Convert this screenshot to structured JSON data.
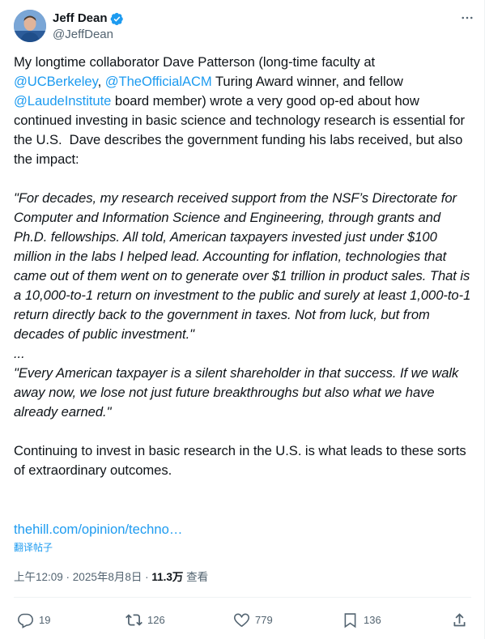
{
  "author": {
    "display_name": "Jeff Dean",
    "handle": "@JeffDean",
    "verified": true,
    "verified_color": "#1d9bf0"
  },
  "tweet": {
    "p1_a": "My longtime collaborator Dave Patterson (long-time faculty at",
    "mention_ucb": "@UCBerkeley",
    "comma": ", ",
    "mention_acm": "@TheOfficialACM",
    "p1_b": " Turing Award winner, and fellow",
    "mention_laude": "@LaudeInstitute",
    "p1_c": " board member) wrote a very good op-ed about how continued investing in basic science and technology research is essential for the U.S.  Dave describes the government funding his labs received, but also the impact:",
    "quote1": "\"For decades, my research received support from the NSF’s Directorate for Computer and Information Science and Engineering, through grants and Ph.D. fellowships. All told, American taxpayers invested just under $100 million in the labs I helped lead. Accounting for inflation, technologies that came out of them went on to generate over $1 trillion in product sales. That is a 10,000-to-1 return on investment to the public and surely at least 1,000-to-1 return directly back to the government in taxes. Not from luck, but from decades of public investment.\"",
    "ellipsis": "...",
    "quote2": "\"Every American taxpayer is a silent shareholder in that success. If we walk away now, we lose not just future breakthroughs but also what we have already earned.\"",
    "p3": "Continuing to invest in basic research in the U.S. is what leads to these sorts of extraordinary outcomes.",
    "link": "thehill.com/opinion/techno…",
    "translate": "翻译帖子"
  },
  "meta": {
    "time": "上午12:09",
    "sep1": " · ",
    "date": "2025年8月8日",
    "sep2": " · ",
    "views": "11.3万",
    "views_label": " 查看"
  },
  "actions": {
    "replies": "19",
    "reposts": "126",
    "likes": "779",
    "bookmarks": "136"
  },
  "icons": {
    "more": "more-dots-icon",
    "reply": "reply-icon",
    "repost": "repost-icon",
    "like": "heart-icon",
    "bookmark": "bookmark-icon",
    "share": "share-icon"
  }
}
